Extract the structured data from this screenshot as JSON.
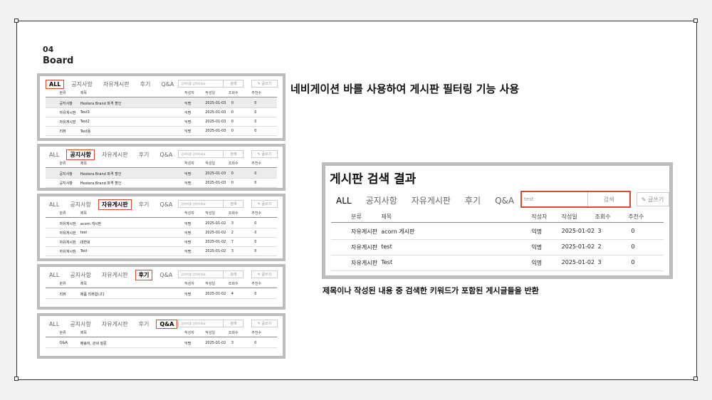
{
  "section": {
    "number": "04",
    "title": "Board"
  },
  "captions": {
    "nav_filter": "네비게이션 바를 사용하여 게시판 필터링 기능 사용",
    "search_result_title": "게시판 검색 결과",
    "search_desc": "제목이나 작성된 내용 중 검색한 키워드가 포함된 게시글들을 반환"
  },
  "tabs": [
    "ALL",
    "공지사항",
    "자유게시판",
    "후기",
    "Q&A"
  ],
  "search": {
    "placeholder": "검색어를 입력하세요",
    "button": "검색",
    "write_button": "✎ 글쓰기",
    "query": "test"
  },
  "columns": [
    "분류",
    "제목",
    "작성자",
    "작성일",
    "조회수",
    "추천수"
  ],
  "panels": [
    {
      "active_tab": 0,
      "rows": [
        [
          "공지사항",
          "Hestera Brand 파격 할인",
          "익명",
          "2025-01-03",
          "0",
          "0"
        ],
        [
          "자유게시판",
          "Test3",
          "익명",
          "2025-01-03",
          "0",
          "0"
        ],
        [
          "자유게시판",
          "Test2",
          "익명",
          "2025-01-03",
          "0",
          "0"
        ],
        [
          "리뷰",
          "Test용",
          "익명",
          "2025-01-03",
          "0",
          "0"
        ]
      ]
    },
    {
      "active_tab": 1,
      "rows": [
        [
          "공지사항",
          "Hestera Brand 파격 할인",
          "익명",
          "2025-01-03",
          "0",
          "0"
        ],
        [
          "공지사항",
          "Hestera Brand 파격 할인",
          "익명",
          "2025-01-03",
          "0",
          "0"
        ]
      ]
    },
    {
      "active_tab": 2,
      "rows": [
        [
          "자유게시판",
          "acorn 게시판",
          "익명",
          "2025-01-02",
          "3",
          "0"
        ],
        [
          "자유게시판",
          "test",
          "익명",
          "2025-01-02",
          "2",
          "0"
        ],
        [
          "자유게시판",
          "대변희",
          "익명",
          "2025-01-02",
          "7",
          "0"
        ],
        [
          "자유게시판",
          "Test",
          "익명",
          "2025-01-02",
          "3",
          "0"
        ]
      ]
    },
    {
      "active_tab": 3,
      "rows": [
        [
          "리뷰",
          "제품 리뷰합니다",
          "익명",
          "2025-01-02",
          "4",
          "0"
        ]
      ]
    },
    {
      "active_tab": 4,
      "rows": [
        [
          "Q&A",
          "배송비, 관세 질문",
          "익명",
          "2025-01-02",
          "3",
          "0"
        ]
      ]
    }
  ],
  "result": {
    "rows": [
      [
        "자유게시판",
        "acorn 게시판",
        "익명",
        "2025-01-02",
        "3",
        "0"
      ],
      [
        "자유게시판",
        "test",
        "익명",
        "2025-01-02",
        "2",
        "0"
      ],
      [
        "자유게시판",
        "Test",
        "익명",
        "2025-01-02",
        "3",
        "0"
      ]
    ]
  },
  "colors": {
    "accent": "#d84a2b",
    "panel_border": "#bdbdbd"
  }
}
